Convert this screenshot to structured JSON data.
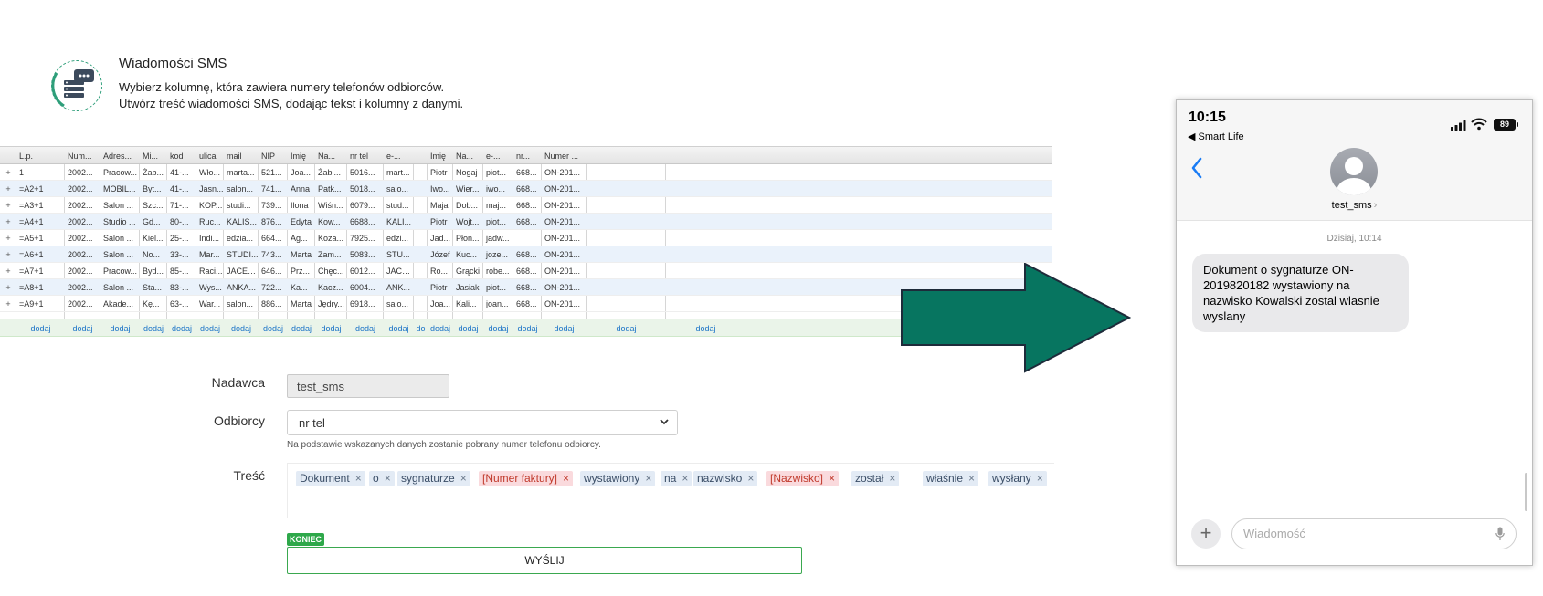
{
  "header": {
    "title": "Wiadomości SMS",
    "line1": "Wybierz kolumnę, która zawiera numery telefonów odbiorców.",
    "line2": "Utwórz treść wiadomości SMS, dodając tekst i kolumny z danymi."
  },
  "grid": {
    "headers": [
      "",
      "L.p.",
      "Num...",
      "Adres...",
      "Mi...",
      "kod",
      "ulica",
      "mail",
      "NIP",
      "Imię",
      "Na...",
      "nr tel",
      "e-...",
      "",
      "Imię",
      "Na...",
      "e-...",
      "nr...",
      "Numer ...",
      "",
      ""
    ],
    "rows": [
      [
        "+",
        "1",
        "2002...",
        "Pracow...",
        "Żab...",
        "41-...",
        "Wło...",
        "marta...",
        "521...",
        "Joa...",
        "Żabi...",
        "5016...",
        "mart...",
        "",
        "Piotr",
        "Nogaj",
        "piot...",
        "668...",
        "ON-201...",
        "",
        ""
      ],
      [
        "+",
        "=A2+1",
        "2002...",
        "MOBIL...",
        "Byt...",
        "41-...",
        "Jasn...",
        "salon...",
        "741...",
        "Anna",
        "Patk...",
        "5018...",
        "salo...",
        "",
        "Iwo...",
        "Wier...",
        "iwo...",
        "668...",
        "ON-201...",
        "",
        ""
      ],
      [
        "+",
        "=A3+1",
        "2002...",
        "Salon ...",
        "Szc...",
        "71-...",
        "KOP...",
        "studi...",
        "739...",
        "Ilona",
        "Wiśn...",
        "6079...",
        "stud...",
        "",
        "Maja",
        "Dob...",
        "maj...",
        "668...",
        "ON-201...",
        "",
        ""
      ],
      [
        "+",
        "=A4+1",
        "2002...",
        "Studio ...",
        "Gd...",
        "80-...",
        "Ruc...",
        "KALIS...",
        "876...",
        "Edyta",
        "Kow...",
        "6688...",
        "KALI...",
        "",
        "Piotr",
        "Wojt...",
        "piot...",
        "668...",
        "ON-201...",
        "",
        ""
      ],
      [
        "+",
        "=A5+1",
        "2002...",
        "Salon ...",
        "Kiel...",
        "25-...",
        "Indi...",
        "edzia...",
        "664...",
        "Ag...",
        "Koza...",
        "7925...",
        "edzi...",
        "",
        "Jad...",
        "Płon...",
        "jadw...",
        "",
        "ON-201...",
        "",
        ""
      ],
      [
        "+",
        "=A6+1",
        "2002...",
        "Salon ...",
        "No...",
        "33-...",
        "Mar...",
        "STUDI...",
        "743...",
        "Marta",
        "Zam...",
        "5083...",
        "STU...",
        "",
        "Józef",
        "Kuc...",
        "joze...",
        "668...",
        "ON-201...",
        "",
        ""
      ],
      [
        "+",
        "=A7+1",
        "2002...",
        "Pracow...",
        "Byd...",
        "85-...",
        "Raci...",
        "JACEK...",
        "646...",
        "Prz...",
        "Chęc...",
        "6012...",
        "JACE...",
        "",
        "Ro...",
        "Grącki",
        "robe...",
        "668...",
        "ON-201...",
        "",
        ""
      ],
      [
        "+",
        "=A8+1",
        "2002...",
        "Salon ...",
        "Sta...",
        "83-...",
        "Wys...",
        "ANKA...",
        "722...",
        "Ka...",
        "Kacz...",
        "6004...",
        "ANK...",
        "",
        "Piotr",
        "Jasiak",
        "piot...",
        "668...",
        "ON-201...",
        "",
        ""
      ],
      [
        "+",
        "=A9+1",
        "2002...",
        "Akade...",
        "Kę...",
        "63-...",
        "War...",
        "salon...",
        "886...",
        "Marta",
        "Jędry...",
        "6918...",
        "salo...",
        "",
        "Joa...",
        "Kali...",
        "joan...",
        "668...",
        "ON-201...",
        "",
        ""
      ]
    ],
    "footer": [
      "",
      "dodaj",
      "dodaj",
      "dodaj",
      "dodaj",
      "dodaj",
      "dodaj",
      "dodaj",
      "dodaj",
      "dodaj",
      "dodaj",
      "dodaj",
      "dodaj",
      "do",
      "dodaj",
      "dodaj",
      "dodaj",
      "dodaj",
      "dodaj",
      "dodaj",
      "dodaj"
    ]
  },
  "form": {
    "sender_label": "Nadawca",
    "sender_value": "test_sms",
    "recipients_label": "Odbiorcy",
    "recipients_selected": "nr tel",
    "recipients_hint": "Na podstawie wskazanych danych zostanie pobrany numer telefonu odbiorcy.",
    "content_label": "Treść",
    "tags": [
      {
        "label": "Dokument",
        "kind": "text"
      },
      {
        "label": "o",
        "kind": "text"
      },
      {
        "label": "sygnaturze",
        "kind": "text"
      },
      {
        "label": "[Numer faktury]",
        "kind": "var"
      },
      {
        "label": "wystawiony",
        "kind": "text"
      },
      {
        "label": "na",
        "kind": "text"
      },
      {
        "label": "nazwisko",
        "kind": "text"
      },
      {
        "label": "[Nazwisko]",
        "kind": "var"
      },
      {
        "label": "został",
        "kind": "text"
      },
      {
        "label": "właśnie",
        "kind": "text"
      },
      {
        "label": "wysłany",
        "kind": "text"
      }
    ],
    "tag_remove": "×",
    "end_badge": "KONIEC",
    "send_label": "WYŚLIJ"
  },
  "colors": {
    "arrow": "#077560",
    "accent_green": "#2ea84a",
    "link_blue": "#1a73c7",
    "ios_blue": "#1a7cf5"
  },
  "phone": {
    "time": "10:15",
    "back_app": "◀ Smart Life",
    "battery": "89",
    "contact": "test_sms",
    "contact_chevron": "›",
    "date": "Dzisiaj, 10:14",
    "message": "Dokument o sygnaturze ON-2019820182 wystawiony na nazwisko Kowalski zostal wlasnie wyslany",
    "input_placeholder": "Wiadomość",
    "plus": "+"
  }
}
